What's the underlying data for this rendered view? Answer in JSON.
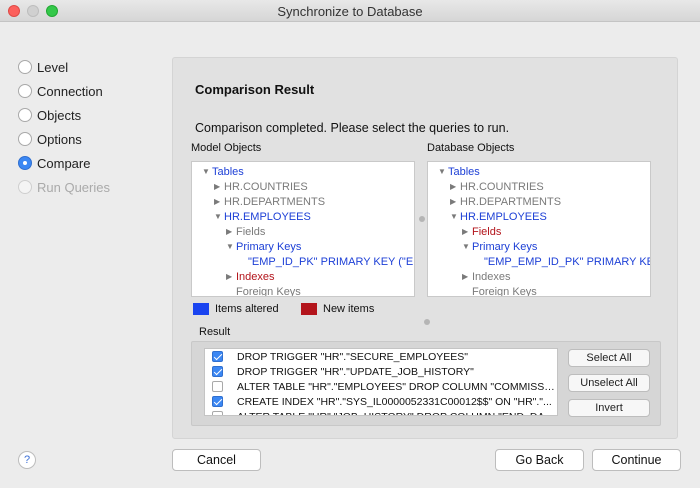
{
  "window": {
    "title": "Synchronize to Database"
  },
  "steps": [
    {
      "label": "Level",
      "state": "normal"
    },
    {
      "label": "Connection",
      "state": "normal"
    },
    {
      "label": "Objects",
      "state": "normal"
    },
    {
      "label": "Options",
      "state": "normal"
    },
    {
      "label": "Compare",
      "state": "selected"
    },
    {
      "label": "Run Queries",
      "state": "disabled"
    }
  ],
  "main": {
    "title": "Comparison Result",
    "message": "Comparison completed. Please select the queries to run.",
    "model_header": "Model Objects",
    "db_header": "Database Objects",
    "model_tree": [
      {
        "label": "Tables",
        "expander": "open",
        "color": "blue"
      },
      {
        "label": "HR.COUNTRIES",
        "expander": "closed",
        "color": "gray"
      },
      {
        "label": "HR.DEPARTMENTS",
        "expander": "closed",
        "color": "gray"
      },
      {
        "label": "HR.EMPLOYEES",
        "expander": "open",
        "color": "blue"
      },
      {
        "label": "Fields",
        "expander": "closed",
        "color": "gray"
      },
      {
        "label": "Primary Keys",
        "expander": "open",
        "color": "blue"
      },
      {
        "label": "\"EMP_ID_PK\" PRIMARY KEY (\"EMP",
        "expander": "none",
        "color": "blue"
      },
      {
        "label": "Indexes",
        "expander": "closed",
        "color": "red"
      },
      {
        "label": "Foreign Keys",
        "expander": "none",
        "color": "gray"
      }
    ],
    "db_tree": [
      {
        "label": "Tables",
        "expander": "open",
        "color": "blue"
      },
      {
        "label": "HR.COUNTRIES",
        "expander": "closed",
        "color": "gray"
      },
      {
        "label": "HR.DEPARTMENTS",
        "expander": "closed",
        "color": "gray"
      },
      {
        "label": "HR.EMPLOYEES",
        "expander": "open",
        "color": "blue"
      },
      {
        "label": "Fields",
        "expander": "closed",
        "color": "red"
      },
      {
        "label": "Primary Keys",
        "expander": "open",
        "color": "blue"
      },
      {
        "label": "\"EMP_EMP_ID_PK\" PRIMARY KEY (\"E",
        "expander": "none",
        "color": "blue"
      },
      {
        "label": "Indexes",
        "expander": "closed",
        "color": "gray"
      },
      {
        "label": "Foreign Keys",
        "expander": "none",
        "color": "gray"
      }
    ],
    "legend": {
      "altered": {
        "label": "Items altered",
        "color": "#1a44f0"
      },
      "new": {
        "label": "New items",
        "color": "#b3141b"
      }
    },
    "result_label": "Result",
    "queries": [
      {
        "text": "DROP TRIGGER \"HR\".\"SECURE_EMPLOYEES\"",
        "checked": true
      },
      {
        "text": "DROP TRIGGER \"HR\".\"UPDATE_JOB_HISTORY\"",
        "checked": true
      },
      {
        "text": "ALTER TABLE \"HR\".\"EMPLOYEES\" DROP COLUMN \"COMMISSIO...",
        "checked": false
      },
      {
        "text": "CREATE INDEX \"HR\".\"SYS_IL0000052331C00012$$\" ON \"HR\".\"...",
        "checked": true
      },
      {
        "text": "ALTER TABLE \"HR\".\"JOB_HISTORY\" DROP COLUMN \"END_DATE\"",
        "checked": false
      }
    ],
    "buttons": {
      "select_all": "Select All",
      "unselect_all": "Unselect All",
      "invert": "Invert"
    }
  },
  "footer": {
    "help": "?",
    "cancel": "Cancel",
    "back": "Go Back",
    "continue": "Continue"
  },
  "colors": {
    "accent": "#3b87f3",
    "tree_blue": "#1c3fd6",
    "tree_red": "#b3141b",
    "tree_gray": "#7a7a7a"
  }
}
